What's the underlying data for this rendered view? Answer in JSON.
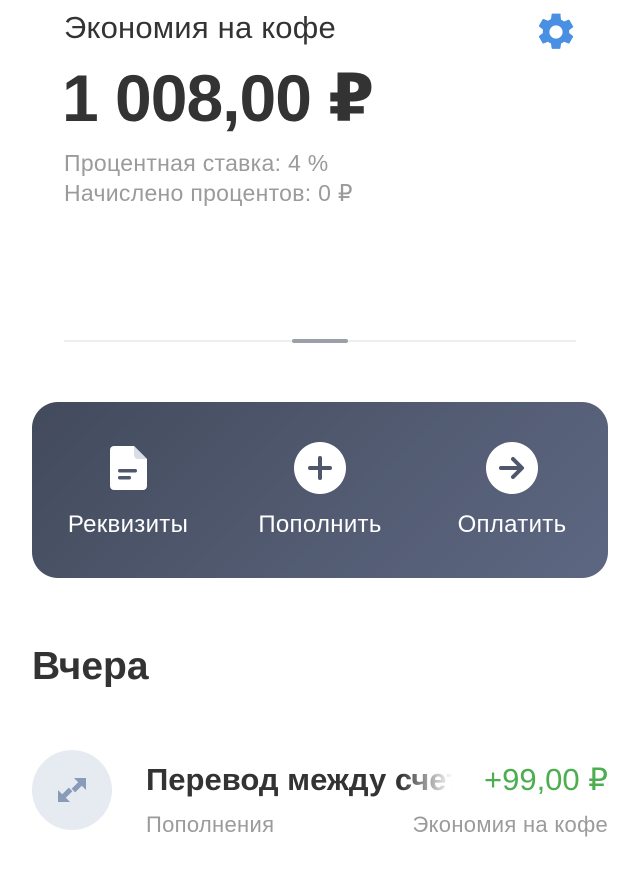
{
  "account": {
    "name": "Экономия на кофе",
    "balance": "1 008,00 ₽",
    "interest_rate": "Процентная ставка: 4 %",
    "interest_accrued": "Начислено процентов: 0 ₽",
    "settings_icon": "gear-icon"
  },
  "actions": [
    {
      "label": "Реквизиты",
      "icon": "document-icon"
    },
    {
      "label": "Пополнить",
      "icon": "plus-circle-icon"
    },
    {
      "label": "Оплатить",
      "icon": "arrow-right-circle-icon"
    }
  ],
  "history": {
    "section_title": "Вчера",
    "transactions": [
      {
        "title": "Перевод между счетами",
        "category": "Пополнения",
        "amount": "+99,00 ₽",
        "account": "Экономия на кофе",
        "icon": "transfer-arrows-icon"
      }
    ]
  },
  "colors": {
    "accent": "#4a90e2",
    "card_gradient_start": "#424a5c",
    "card_gradient_end": "#5d6782",
    "positive_amount": "#4cae4f",
    "secondary_text": "#9b9b9b"
  }
}
